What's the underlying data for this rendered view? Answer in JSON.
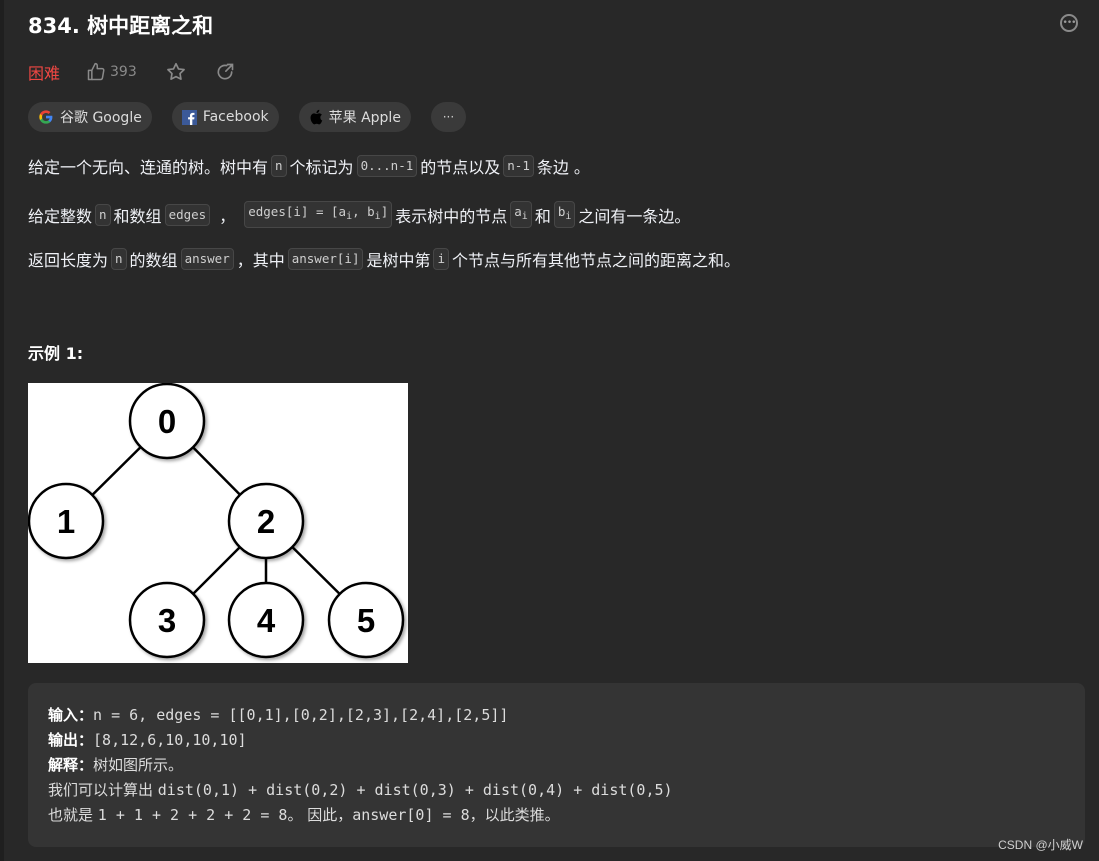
{
  "problem": {
    "title": "834. 树中距离之和",
    "difficulty": "困难",
    "likes": "393",
    "colors": {
      "difficulty": "#ef4743",
      "background": "#282828",
      "example_bg": "#343434"
    }
  },
  "icons": {
    "more": "more-options-icon",
    "like": "thumbs-up-icon",
    "star": "star-icon",
    "share": "share-icon"
  },
  "companies": [
    {
      "label": "谷歌 Google",
      "icon": "google-icon"
    },
    {
      "label": "Facebook",
      "icon": "facebook-icon"
    },
    {
      "label": "苹果 Apple",
      "icon": "apple-icon"
    },
    {
      "label": "···",
      "icon": "more-horizontal-icon"
    }
  ],
  "description": {
    "p1": {
      "t1": "给定一个无向、连通的树。树中有",
      "c1": "n",
      "t2": "个标记为",
      "c2": "0...n-1",
      "t3": "的节点以及",
      "c3": "n-1",
      "t4": "条边 。"
    },
    "p2": {
      "t1": "给定整数",
      "c1": "n",
      "t2": "和数组",
      "c2": "edges",
      "t3": "，",
      "c3a": "edges[i] = [a",
      "c3sub1": "i",
      "c3b": ", b",
      "c3sub2": "i",
      "c3c": "]",
      "t4": "表示树中的节点",
      "c4": "a",
      "c4sub": "i",
      "t5": "和",
      "c5": "b",
      "c5sub": "i",
      "t6": "之间有一条边。"
    },
    "p3": {
      "t1": "返回长度为",
      "c1": "n",
      "t2": "的数组",
      "c2": "answer",
      "t3": "，其中",
      "c3": "answer[i]",
      "t4": "是树中第",
      "c4": "i",
      "t5": "个节点与所有其他节点之间的距离之和。"
    }
  },
  "example": {
    "title": "示例 1:",
    "tree": {
      "nodes": [
        "0",
        "1",
        "2",
        "3",
        "4",
        "5"
      ],
      "edges": [
        [
          "0",
          "1"
        ],
        [
          "0",
          "2"
        ],
        [
          "2",
          "3"
        ],
        [
          "2",
          "4"
        ],
        [
          "2",
          "5"
        ]
      ]
    },
    "input_label": "输入：",
    "input_value": "n = 6, edges = [[0,1],[0,2],[2,3],[2,4],[2,5]]",
    "output_label": "输出：",
    "output_value": "[8,12,6,10,10,10]",
    "explain_label": "解释：",
    "explain_value": "树如图所示。",
    "line4_cn": "我们可以计算出 ",
    "line4_code": "dist(0,1) + dist(0,2) + dist(0,3) + dist(0,4) + dist(0,5)",
    "line5_cn": "也就是 ",
    "line5_code": "1 + 1 + 2 + 2 + 2 = 8",
    "line5_cn2": "。 因此，",
    "line5_code2": "answer[0] = 8",
    "line5_cn3": "，以此类推。"
  },
  "watermark": "CSDN @小威W"
}
